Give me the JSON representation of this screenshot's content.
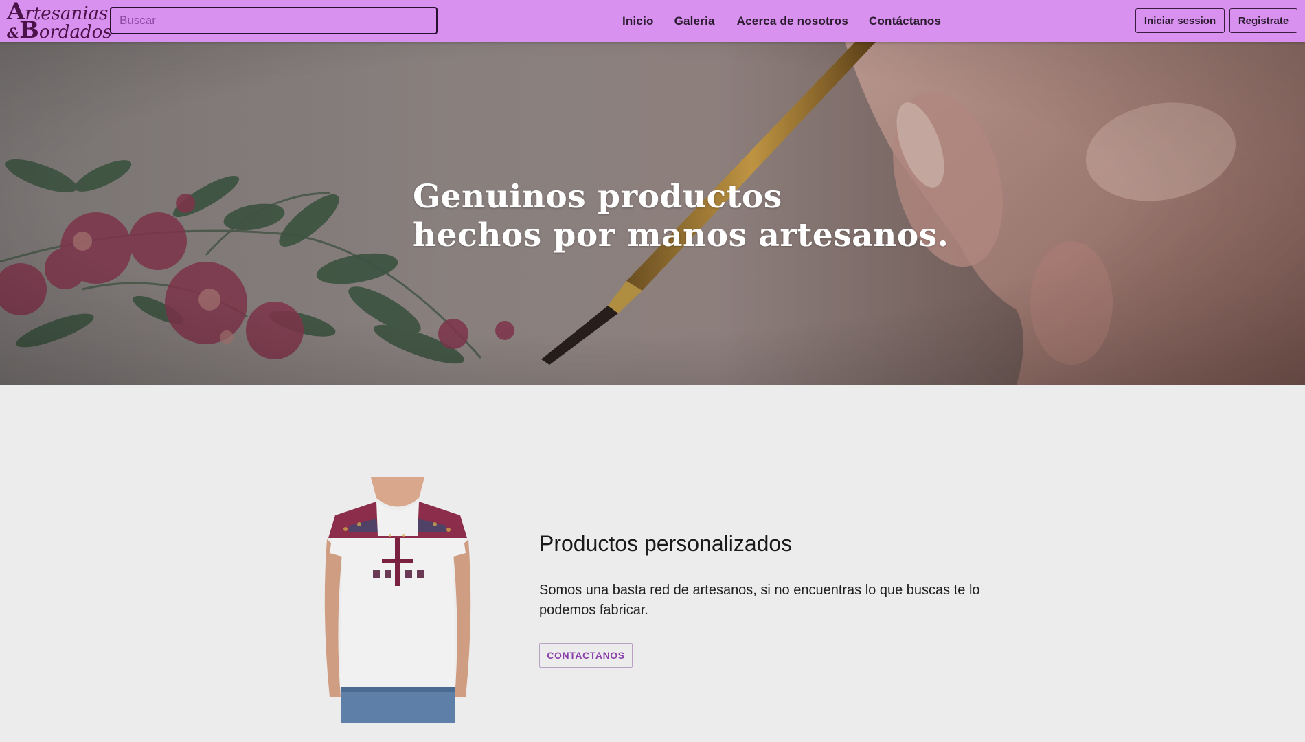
{
  "brand": {
    "logo_line1_initial": "A",
    "logo_line1_rest": "rtesanias",
    "logo_line2_amp": "&",
    "logo_line2_initial": "B",
    "logo_line2_rest": "ordados"
  },
  "search": {
    "placeholder": "Buscar"
  },
  "nav": {
    "items": [
      {
        "label": "Inicio"
      },
      {
        "label": "Galeria"
      },
      {
        "label": "Acerca de nosotros"
      },
      {
        "label": "Contáctanos"
      }
    ]
  },
  "auth": {
    "login_label": "Iniciar session",
    "register_label": "Registrate"
  },
  "hero": {
    "title_line1": "Genuinos productos",
    "title_line2": "hechos por manos artesanos."
  },
  "feature": {
    "title": "Productos personalizados",
    "text": "Somos una basta red de artesanos, si no encuentras lo que buscas te lo podemos fabricar.",
    "button_label": "CONTACTANOS"
  },
  "colors": {
    "navbar_bg": "#d891ef",
    "page_bg": "#ececec",
    "accent_text": "#8a3fab",
    "logo_text": "#4a1248"
  }
}
